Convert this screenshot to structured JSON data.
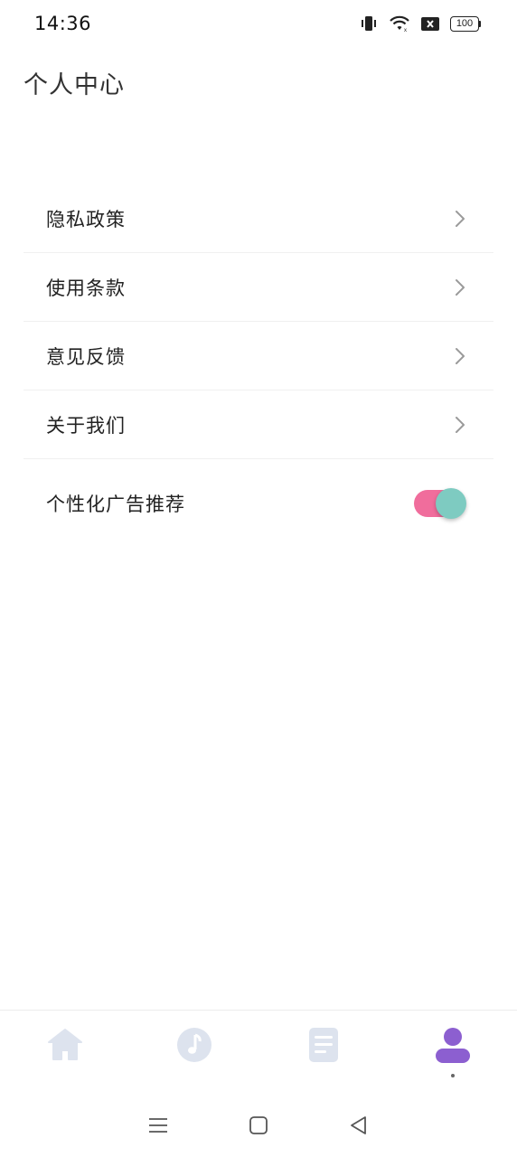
{
  "status_bar": {
    "time": "14:36",
    "battery": "100",
    "icons": [
      "vibrate-icon",
      "wifi-icon",
      "sim-disabled-icon",
      "battery-icon"
    ]
  },
  "page": {
    "title": "个人中心"
  },
  "settings": {
    "items": [
      {
        "label": "隐私政策",
        "icon": "chevron-right-icon"
      },
      {
        "label": "使用条款",
        "icon": "chevron-right-icon"
      },
      {
        "label": "意见反馈",
        "icon": "chevron-right-icon"
      },
      {
        "label": "关于我们",
        "icon": "chevron-right-icon"
      }
    ],
    "toggle": {
      "label": "个性化广告推荐",
      "state": "on",
      "track_color": "#f06d9c",
      "knob_color": "#7ecbc1"
    }
  },
  "tab_bar": {
    "tabs": [
      {
        "icon": "home-icon",
        "active": false
      },
      {
        "icon": "music-note-icon",
        "active": false
      },
      {
        "icon": "document-icon",
        "active": false
      },
      {
        "icon": "profile-icon",
        "active": true
      }
    ],
    "inactive_color": "#dde3ee",
    "active_color": "#8c5fd0"
  },
  "nav_bar": {
    "buttons": [
      "menu-icon",
      "home-square-icon",
      "back-triangle-icon"
    ]
  }
}
